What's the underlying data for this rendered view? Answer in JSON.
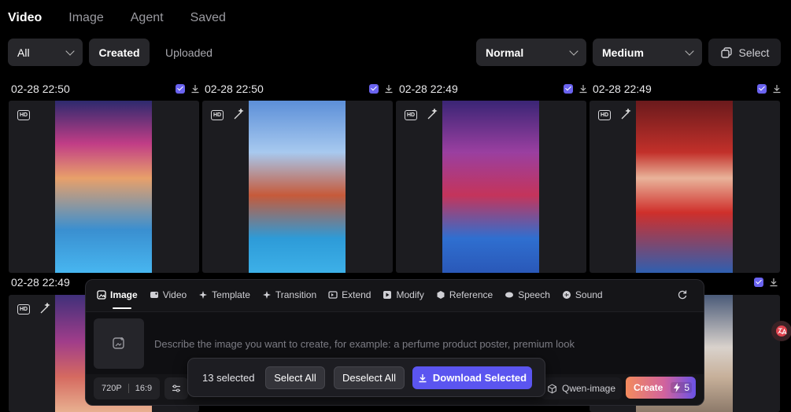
{
  "top_tabs": [
    "Video",
    "Image",
    "Agent",
    "Saved"
  ],
  "filters": {
    "all_dropdown": "All",
    "created": "Created",
    "uploaded": "Uploaded",
    "quality_dropdown": "Normal",
    "size_dropdown": "Medium",
    "select_label": "Select"
  },
  "cards": [
    {
      "timestamp": "02-28 22:50",
      "hd": "HD"
    },
    {
      "timestamp": "02-28 22:50",
      "hd": "HD"
    },
    {
      "timestamp": "02-28 22:49",
      "hd": "HD"
    },
    {
      "timestamp": "02-28 22:49",
      "hd": "HD"
    },
    {
      "timestamp": "02-28 22:49",
      "hd": "HD"
    }
  ],
  "composer": {
    "tabs": [
      "Image",
      "Video",
      "Template",
      "Transition",
      "Extend",
      "Modify",
      "Reference",
      "Speech",
      "Sound"
    ],
    "prompt_placeholder": "Describe the image you want to create, for example: a perfume product poster, premium look",
    "resolution": "720P",
    "ratio": "16:9",
    "model": "Qwen-image",
    "create_label": "Create",
    "cost": "5"
  },
  "selection": {
    "count_text": "13 selected",
    "select_all": "Select All",
    "deselect_all": "Deselect All",
    "download_selected": "Download Selected"
  },
  "colors": {
    "accent": "#5b55f0",
    "check": "#6a63f0",
    "background": "#000000"
  }
}
